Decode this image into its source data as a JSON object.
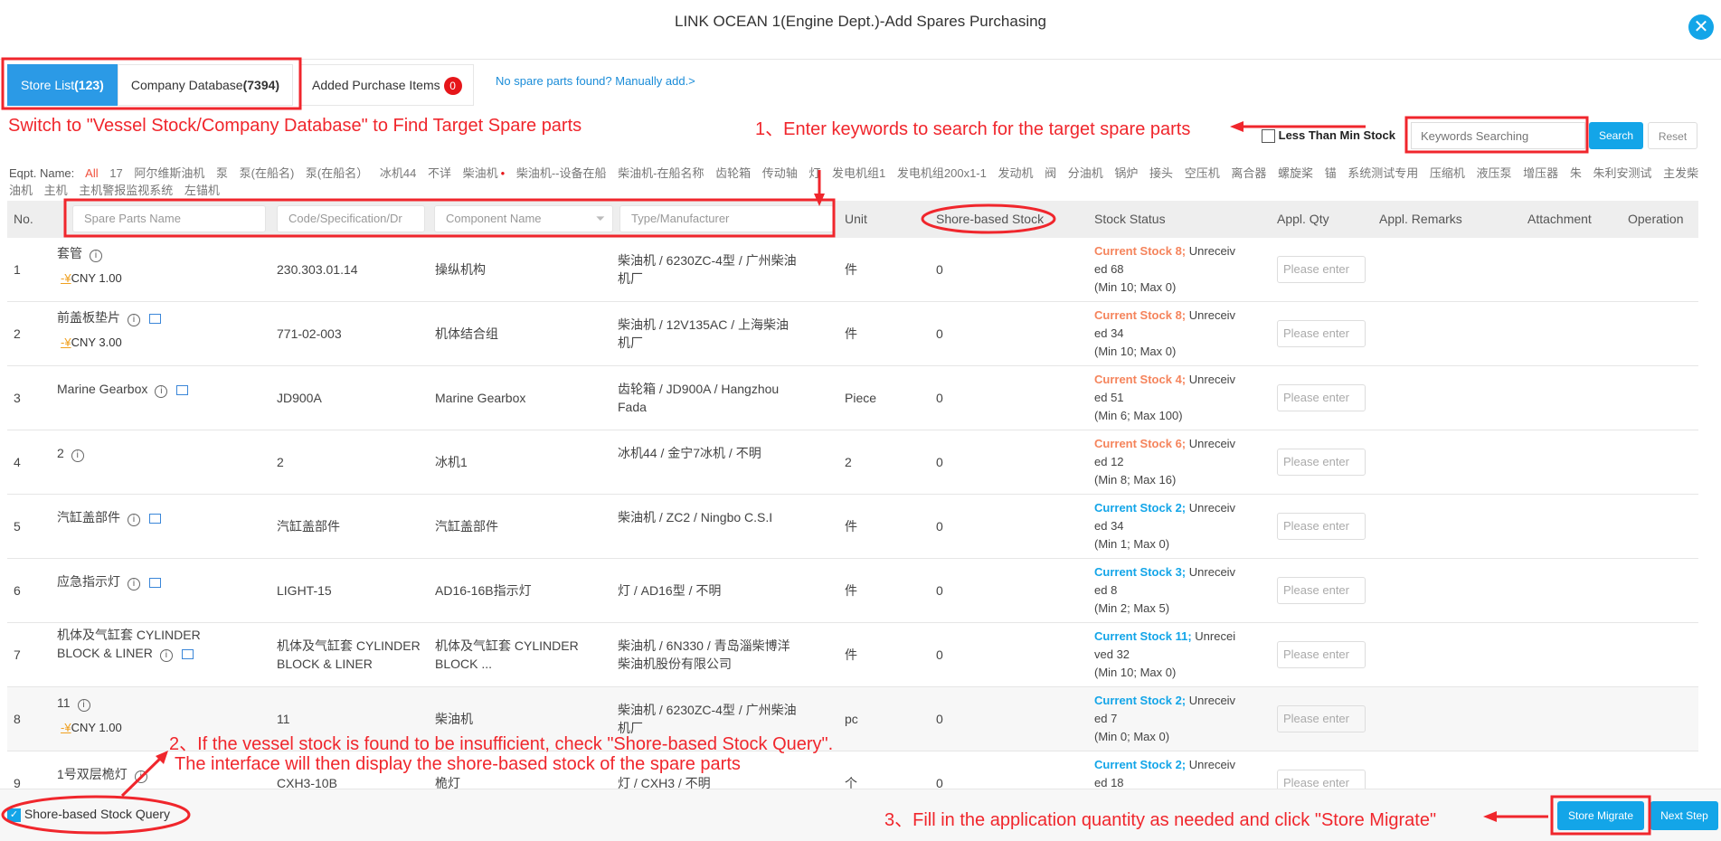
{
  "header": {
    "title": "LINK OCEAN 1(Engine Dept.)-Add Spares Purchasing",
    "close_icon": "close-icon"
  },
  "tabs": [
    {
      "label": "Store List",
      "count": "(123)"
    },
    {
      "label": "Company Database",
      "count": "(7394)"
    }
  ],
  "added_items": {
    "label": "Added Purchase Items",
    "count": "0"
  },
  "manual_add": "No spare parts found? Manually add.>",
  "search": {
    "less_than_min": "Less Than Min Stock",
    "placeholder": "Keywords Searching",
    "search": "Search",
    "reset": "Reset"
  },
  "eqpt": {
    "label": "Eqpt. Name:",
    "items": [
      "All",
      "17",
      "阿尔维斯油机",
      "泵",
      "泵(在船名)",
      "泵(在船名）",
      "冰机44",
      "不详",
      "柴油机",
      "柴油机--设备在船",
      "柴油机-在船名称",
      "齿轮箱",
      "传动轴",
      "灯",
      "发电机组1",
      "发电机组200x1-1",
      "发动机",
      "阀",
      "分油机",
      "锅炉",
      "接头",
      "空压机",
      "离合器",
      "螺旋桨",
      "锚",
      "系统测试专用",
      "压缩机",
      "液压泵",
      "增压器",
      "朱",
      "朱利安测试",
      "主发柴油机",
      "主机",
      "主机警报监视系统",
      "左锚机"
    ]
  },
  "table": {
    "headers": {
      "no": "No.",
      "unit": "Unit",
      "shore": "Shore-based Stock",
      "status": "Stock Status",
      "qty": "Appl. Qty",
      "remarks": "Appl. Remarks",
      "attachment": "Attachment",
      "operation": "Operation"
    },
    "filters": {
      "name": "Spare Parts Name",
      "code": "Code/Specification/Dr",
      "component": "Component Name",
      "type": "Type/Manufacturer"
    },
    "qty_placeholder": "Please enter",
    "status_colors": {
      "low": "#f5845c",
      "ok": "#13a5e8"
    },
    "rows": [
      {
        "no": "1",
        "name": "套管",
        "price": "CNY 1.00",
        "img": false,
        "code": "230.303.01.14",
        "component": "操纵机构",
        "type": "柴油机 / 6230ZC-4型 / 广州柴油机厂",
        "unit": "件",
        "shore": "0",
        "stock": "Current Stock 8;",
        "level": "low",
        "unrec": "Unreceived 68",
        "minmax": "(Min 10; Max 0)"
      },
      {
        "no": "2",
        "name": "前盖板垫片",
        "price": "CNY 3.00",
        "img": true,
        "code": "771-02-003",
        "component": "机体结合组",
        "type": "柴油机 / 12V135AC / 上海柴油机厂",
        "unit": "件",
        "shore": "0",
        "stock": "Current Stock 8;",
        "level": "low",
        "unrec": "Unreceived 34",
        "minmax": "(Min 10; Max 0)"
      },
      {
        "no": "3",
        "name": "Marine Gearbox",
        "price": "",
        "img": true,
        "code": "JD900A",
        "component": "Marine Gearbox",
        "type": "齿轮箱 / JD900A / Hangzhou Fada",
        "unit": "Piece",
        "shore": "0",
        "stock": "Current Stock 4;",
        "level": "low",
        "unrec": "Unreceived 51",
        "minmax": "(Min 6; Max 100)"
      },
      {
        "no": "4",
        "name": "2",
        "price": "",
        "img": false,
        "code": "2",
        "component": "冰机1",
        "type": "冰机44 / 金宁7冰机 / 不明",
        "unit": "2",
        "shore": "0",
        "stock": "Current Stock 6;",
        "level": "low",
        "unrec": "Unreceived 12",
        "minmax": "(Min 8; Max 16)"
      },
      {
        "no": "5",
        "name": "汽缸盖部件",
        "price": "",
        "img": true,
        "code": "汽缸盖部件",
        "component": "汽缸盖部件",
        "type": "柴油机 / ZC2 / Ningbo C.S.I",
        "unit": "件",
        "shore": "0",
        "stock": "Current Stock 2;",
        "level": "ok",
        "unrec": "Unreceived 34",
        "minmax": "(Min 1; Max 0)"
      },
      {
        "no": "6",
        "name": "应急指示灯",
        "price": "",
        "img": true,
        "code": "LIGHT-15",
        "component": "AD16-16B指示灯",
        "type": "灯 / AD16型 / 不明",
        "unit": "件",
        "shore": "0",
        "stock": "Current Stock 3;",
        "level": "ok",
        "unrec": "Unreceived 8",
        "minmax": "(Min 2; Max 5)"
      },
      {
        "no": "7",
        "name": "机体及气缸套 CYLINDER BLOCK & LINER",
        "price": "",
        "img": true,
        "code": "机体及气缸套 CYLINDER BLOCK & LINER",
        "component": "机体及气缸套 CYLINDER BLOCK ...",
        "type": "柴油机 / 6N330 / 青岛淄柴博洋柴油机股份有限公司",
        "unit": "件",
        "shore": "0",
        "stock": "Current Stock 11;",
        "level": "ok",
        "unrec": "Unreceived 32",
        "minmax": "(Min 10; Max 0)"
      },
      {
        "no": "8",
        "name": "11",
        "price": "CNY 1.00",
        "img": false,
        "code": "11",
        "component": "柴油机",
        "type": "柴油机 / 6230ZC-4型 / 广州柴油机厂",
        "unit": "pc",
        "shore": "0",
        "stock": "Current Stock 2;",
        "level": "ok",
        "unrec": "Unreceived 7",
        "minmax": "(Min 0; Max 0)"
      },
      {
        "no": "9",
        "name": "1号双层桅灯",
        "price": "",
        "img": false,
        "code": "CXH3-10B",
        "component": "桅灯",
        "type": "灯 / CXH3 / 不明",
        "unit": "个",
        "shore": "0",
        "stock": "Current Stock 2;",
        "level": "ok",
        "unrec": "Unreceived 18",
        "minmax": ""
      }
    ]
  },
  "footer": {
    "shore_query": "Shore-based Stock Query",
    "shore_query_checked": true,
    "store_migrate": "Store Migrate",
    "next_step": "Next Step"
  },
  "annotations": {
    "switch": "Switch to \"Vessel Stock/Company Database\" to Find Target Spare parts",
    "step1": "1、Enter keywords to search for the target spare parts",
    "step2a": "2、If the vessel stock is found to be insufficient, check \"Shore-based Stock Query\".",
    "step2b": "The interface will then display the shore-based stock of the spare parts",
    "step3": "3、Fill in the application quantity as needed and click \"Store Migrate\"",
    "color": "#f0262c"
  }
}
